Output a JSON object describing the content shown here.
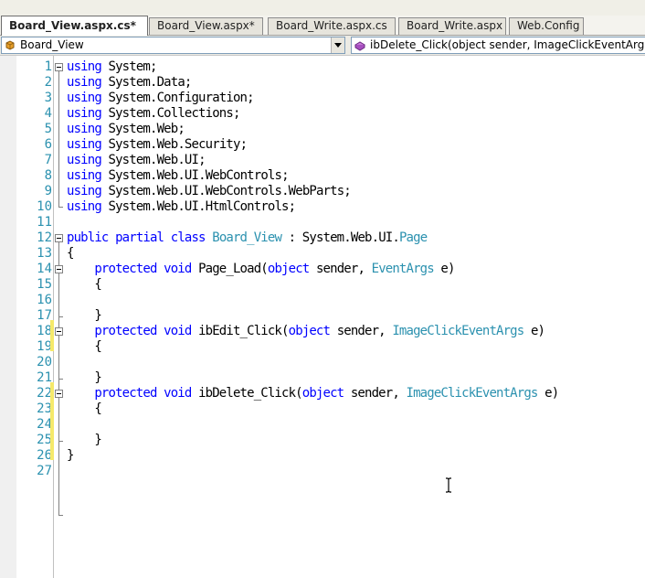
{
  "tabs": [
    {
      "label": "Board_View.aspx.cs*",
      "active": true
    },
    {
      "label": "Board_View.aspx*",
      "active": false
    },
    {
      "label": "Board_Write.aspx.cs",
      "active": false
    },
    {
      "label": "Board_Write.aspx",
      "active": false
    },
    {
      "label": "Web.Config",
      "active": false
    }
  ],
  "navigation": {
    "class_selector": {
      "value": "Board_View",
      "icon": "class-icon"
    },
    "member_selector": {
      "value": "ibDelete_Click(object sender, ImageClickEventArgs e)",
      "icon": "method-icon"
    }
  },
  "editor": {
    "line_numbers": [
      "1",
      "2",
      "3",
      "4",
      "5",
      "6",
      "7",
      "8",
      "9",
      "10",
      "11",
      "12",
      "13",
      "14",
      "15",
      "16",
      "17",
      "18",
      "19",
      "20",
      "21",
      "22",
      "23",
      "24",
      "25",
      "26",
      "27"
    ],
    "lines": [
      "using System;",
      "using System.Data;",
      "using System.Configuration;",
      "using System.Collections;",
      "using System.Web;",
      "using System.Web.Security;",
      "using System.Web.UI;",
      "using System.Web.UI.WebControls;",
      "using System.Web.UI.WebControls.WebParts;",
      "using System.Web.UI.HtmlControls;",
      "",
      "public partial class Board_View : System.Web.UI.Page",
      "{",
      "    protected void Page_Load(object sender, EventArgs e)",
      "    {",
      "",
      "    }",
      "    protected void ibEdit_Click(object sender, ImageClickEventArgs e)",
      "    {",
      "",
      "    }",
      "    protected void ibDelete_Click(object sender, ImageClickEventArgs e)",
      "    {",
      "",
      "    }",
      "}",
      ""
    ]
  },
  "colors": {
    "keyword": "#0000ff",
    "type": "#2b91af",
    "line_number": "#2b91af",
    "change_marker": "#f5e96a"
  }
}
